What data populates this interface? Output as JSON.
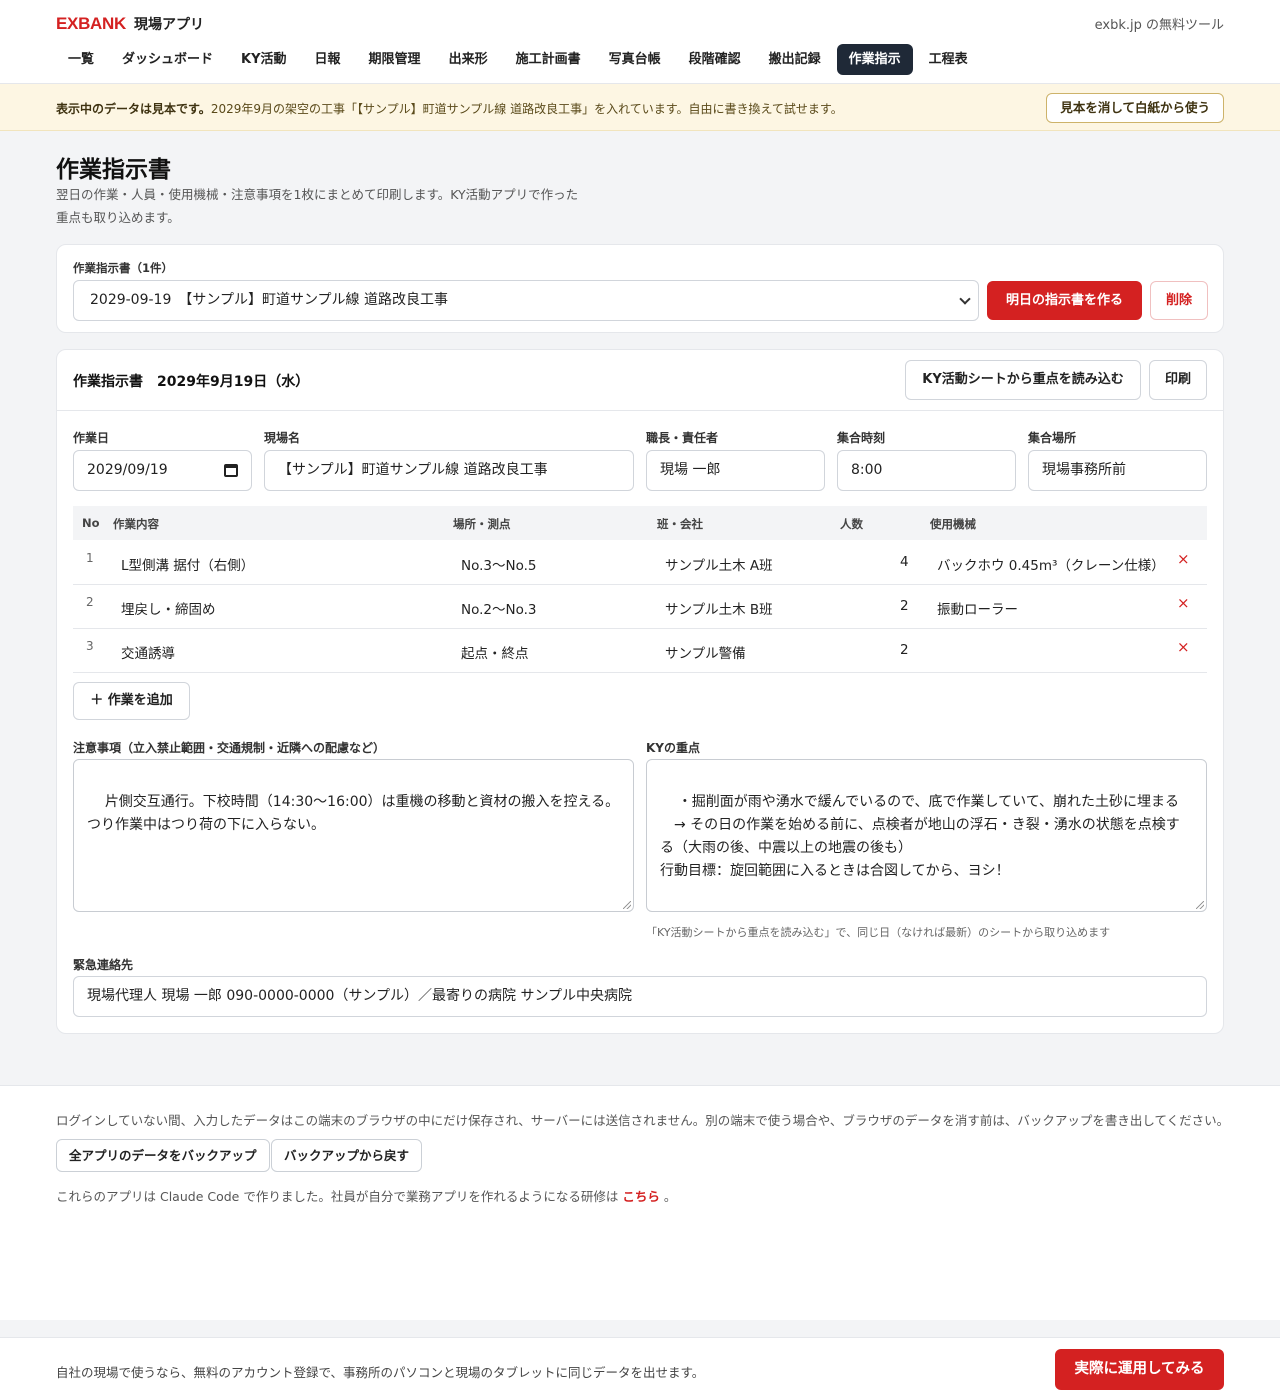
{
  "header": {
    "brand": "EXBANK",
    "app_name": "現場アプリ",
    "external_link": "exbk.jp の無料ツール",
    "nav": [
      "一覧",
      "ダッシュボード",
      "KY活動",
      "日報",
      "期限管理",
      "出来形",
      "施工計画書",
      "写真台帳",
      "段階確認",
      "搬出記録",
      "作業指示",
      "工程表"
    ],
    "active_nav": "作業指示"
  },
  "banner": {
    "bold": "表示中のデータは見本です。",
    "text": "2029年9月の架空の工事「【サンプル】町道サンプル線 道路改良工事」を入れています。自由に書き換えて試せます。",
    "button": "見本を消して白紙から使う"
  },
  "page": {
    "title": "作業指示書",
    "desc_line1": "翌日の作業・人員・使用機械・注意事項を1枚にまとめて印刷します。KY活動アプリで作った",
    "desc_line2": "重点も取り込めます。"
  },
  "selector": {
    "label": "作業指示書（1件）",
    "selected": "2029-09-19　【サンプル】町道サンプル線 道路改良工事",
    "create_button": "明日の指示書を作る",
    "delete_button": "削除"
  },
  "sheet": {
    "heading": "作業指示書　2029年9月19日（水）",
    "import_button": "KY活動シートから重点を読み込む",
    "print_button": "印刷",
    "fields": {
      "date_label": "作業日",
      "date_value": "2029/09/19",
      "site_label": "現場名",
      "site_value": "【サンプル】町道サンプル線 道路改良工事",
      "foreman_label": "職長・責任者",
      "foreman_value": "現場 一郎",
      "time_label": "集合時刻",
      "time_value": "8:00",
      "place_label": "集合場所",
      "place_value": "現場事務所前"
    },
    "table": {
      "headers": [
        "No",
        "作業内容",
        "場所・測点",
        "班・会社",
        "人数",
        "使用機械"
      ],
      "rows": [
        {
          "no": "1",
          "task": "L型側溝 据付（右側）",
          "location": "No.3〜No.5",
          "crew": "サンプル土木 A班",
          "count": "4",
          "machine": "バックホウ 0.45m³（クレーン仕様）"
        },
        {
          "no": "2",
          "task": "埋戻し・締固め",
          "location": "No.2〜No.3",
          "crew": "サンプル土木 B班",
          "count": "2",
          "machine": "振動ローラー"
        },
        {
          "no": "3",
          "task": "交通誘導",
          "location": "起点・終点",
          "crew": "サンプル警備",
          "count": "2",
          "machine": ""
        }
      ],
      "delete_symbol": "×"
    },
    "add_task_button": "＋ 作業を追加",
    "caution_label": "注意事項（立入禁止範囲・交通規制・近隣への配慮など）",
    "caution_text": "片側交互通行。下校時間（14:30〜16:00）は重機の移動と資材の搬入を控える。\nつり作業中はつり荷の下に入らない。",
    "ky_label": "KYの重点",
    "ky_text": "・掘削面が雨や湧水で緩んでいるので、底で作業していて、崩れた土砂に埋まる\n　→ その日の作業を始める前に、点検者が地山の浮石・き裂・湧水の状態を点検する（大雨の後、中震以上の地震の後も）\n行動目標：旋回範囲に入るときは合図してから、ヨシ！",
    "ky_note": "「KY活動シートから重点を読み込む」で、同じ日（なければ最新）のシートから取り込めます",
    "emergency_label": "緊急連絡先",
    "emergency_value": "現場代理人 現場 一郎 090-0000-0000（サンプル）／最寄りの病院 サンプル中央病院"
  },
  "footer": {
    "storage_note": "ログインしていない間、入力したデータはこの端末のブラウザの中にだけ保存され、サーバーには送信されません。別の端末で使う場合や、ブラウザのデータを消す前は、バックアップを書き出してください。",
    "backup_button": "全アプリのデータをバックアップ",
    "restore_button": "バックアップから戻す",
    "made_with_prefix": "これらのアプリは Claude Code で作りました。社員が自分で業務アプリを作れるようになる研修は",
    "made_with_link": "こちら",
    "made_with_suffix": "。"
  },
  "cta": {
    "text": "自社の現場で使うなら、無料のアカウント登録で、事務所のパソコンと現場のタブレットに同じデータを出せます。",
    "button": "実際に運用してみる"
  },
  "colors": {
    "accent": "#d42121",
    "nav_active": "#1f2937",
    "banner_bg": "#fdf6e3"
  }
}
